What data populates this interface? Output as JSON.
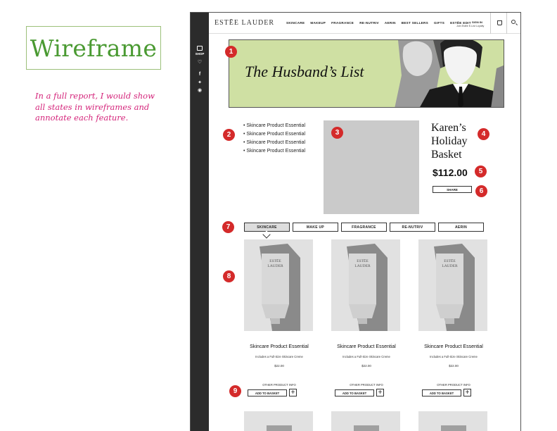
{
  "annotation_panel": {
    "title": "Wireframe",
    "note": "In a full report, I would show all states in wireframes and annotate each feature."
  },
  "side_rail": {
    "shop_label": "SHOP",
    "icons": [
      "heart-icon",
      "facebook-icon",
      "twitter-icon",
      "pinterest-icon"
    ]
  },
  "header": {
    "logo": "ESTĒE LAUDER",
    "nav": [
      "SKINCARE",
      "MAKEUP",
      "FRAGRANCE",
      "RE-NUTRIV",
      "AERIN",
      "BEST SELLERS",
      "GIFTS",
      "ESTĒE EDIT"
    ],
    "sign_in": "SIGN IN",
    "loyalty": "Join Estée E-List Loyalty"
  },
  "banner": {
    "title": "The Husband’s List",
    "background_color": "#cfe0a3"
  },
  "product": {
    "bullets": [
      "Skincare Product Essential",
      "Skincare Product Essential",
      "Skincare Product Essential",
      "Skincare Product Essential"
    ],
    "name": "Karen’s Holiday Basket",
    "price": "$112.00",
    "share_label": "SHARE"
  },
  "tabs": [
    {
      "label": "SKINCARE",
      "active": true
    },
    {
      "label": "MAKE UP",
      "active": false
    },
    {
      "label": "FRAGRANCE",
      "active": false
    },
    {
      "label": "RE-NUTRIV",
      "active": false
    },
    {
      "label": "AERIN",
      "active": false
    }
  ],
  "product_cards": [
    {
      "tube_label": "ESTĒE\nLAUDER",
      "name": "Skincare Product Essential",
      "desc": "Includes a Full-Size Skincare Creme",
      "price": "$22.00",
      "other_info": "OTHER PRODUCT INFO",
      "add_label": "ADD TO BASKET",
      "plus": "+"
    },
    {
      "tube_label": "ESTĒE\nLAUDER",
      "name": "Skincare Product Essential",
      "desc": "Includes a Full-Size Skincare Creme",
      "price": "$22.00",
      "other_info": "OTHER PRODUCT INFO",
      "add_label": "ADD TO BASKET",
      "plus": "+"
    },
    {
      "tube_label": "ESTĒE\nLAUDER",
      "name": "Skincare Product Essential",
      "desc": "Includes a Full-Size Skincare Creme",
      "price": "$22.00",
      "other_info": "OTHER PRODUCT INFO",
      "add_label": "ADD TO BASKET",
      "plus": "+"
    }
  ],
  "markers": [
    "1",
    "2",
    "3",
    "4",
    "5",
    "6",
    "7",
    "8",
    "9"
  ],
  "colors": {
    "accent_title": "#4a9a32",
    "note_text": "#d4237a",
    "marker": "#d42a2a",
    "placeholder_gray": "#cacaca"
  }
}
